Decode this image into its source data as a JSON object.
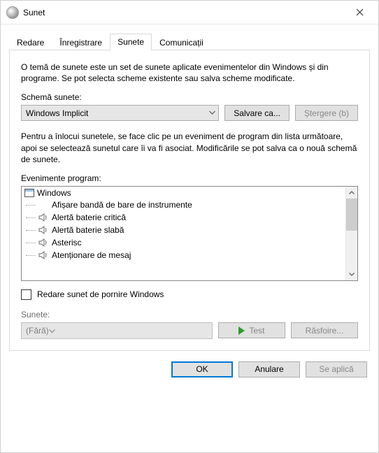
{
  "window": {
    "title": "Sunet"
  },
  "tabs": {
    "playback": "Redare",
    "recording": "Înregistrare",
    "sounds": "Sunete",
    "communications": "Comunicații"
  },
  "desc1": "O temă de sunete este un set de sunete aplicate evenimentelor din Windows și din programe. Se pot selecta scheme existente sau salva scheme modificate.",
  "scheme_label": "Schemă sunete:",
  "scheme_value": "Windows Implicit",
  "save_as": "Salvare ca...",
  "delete": "Ștergere (b)",
  "desc2": "Pentru a înlocui sunetele, se face clic pe un eveniment de program din lista următoare, apoi se selectează sunetul care îi va fi asociat. Modificările se pot salva ca o nouă schemă de sunete.",
  "events_label": "Evenimente program:",
  "tree": {
    "root": "Windows",
    "items": [
      {
        "label": "Afișare bandă de bare de instrumente",
        "icon": false
      },
      {
        "label": "Alertă baterie critică",
        "icon": true
      },
      {
        "label": "Alertă baterie slabă",
        "icon": true
      },
      {
        "label": "Asterisc",
        "icon": true
      },
      {
        "label": "Atenționare de mesaj",
        "icon": true
      }
    ]
  },
  "play_startup": "Redare sunet de pornire Windows",
  "sounds_label": "Sunete:",
  "sounds_value": "(Fără)",
  "test": "Test",
  "browse": "Răsfoire...",
  "footer": {
    "ok": "OK",
    "cancel": "Anulare",
    "apply": "Se aplică"
  }
}
